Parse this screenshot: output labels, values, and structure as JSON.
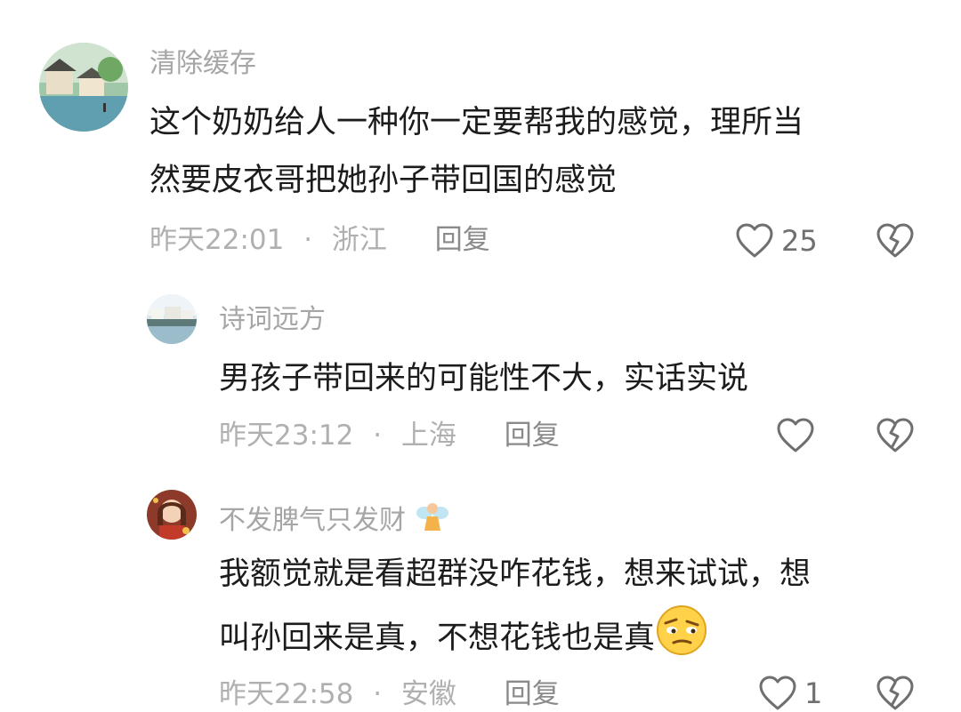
{
  "comments": [
    {
      "username": "清除缓存",
      "lines": [
        "这个奶奶给人一种你一定要帮我的感觉，理所当",
        "然要皮衣哥把她孙子带回国的感觉"
      ],
      "time": "昨天22:01",
      "sep": "·",
      "location": "浙江",
      "reply_label": "回复",
      "likes": "25"
    },
    {
      "username": "诗词远方",
      "lines": [
        "男孩子带回来的可能性不大，实话实说"
      ],
      "time": "昨天23:12",
      "sep": "·",
      "location": "上海",
      "reply_label": "回复",
      "likes": ""
    },
    {
      "username": "不发脾气只发财",
      "username_badge": "fairy-emoji",
      "lines": [
        "我额觉就是看超群没咋花钱，想来试试，想",
        "叫孙回来是真，不想花钱也是真"
      ],
      "trailing_emoji": "skeptical-face-emoji",
      "time": "昨天22:58",
      "sep": "·",
      "location": "安徽",
      "reply_label": "回复",
      "likes": "1"
    }
  ],
  "icons": {
    "like": "heart-outline-icon",
    "dislike": "broken-heart-icon"
  },
  "colors": {
    "text": "#1c1c1c",
    "username": "#a6a6a6",
    "meta": "#b0b0b0",
    "icon": "#6f6f6f"
  }
}
